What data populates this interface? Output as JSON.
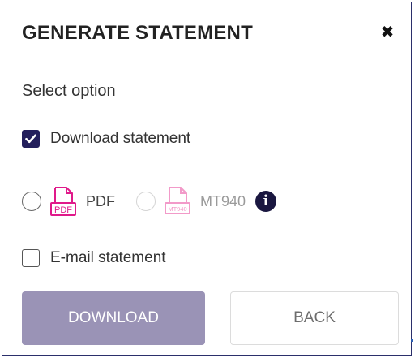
{
  "dialog": {
    "title": "GENERATE STATEMENT",
    "close_symbol": "✖",
    "select_label": "Select option",
    "download_statement": {
      "label": "Download statement",
      "checked": true
    },
    "formats": [
      {
        "label": "PDF",
        "icon": "pdf-file-icon",
        "icon_text": "PDF",
        "enabled": true,
        "selected": false
      },
      {
        "label": "MT940",
        "icon": "mt940-file-icon",
        "icon_text": "MT940",
        "enabled": false,
        "selected": false
      }
    ],
    "info_symbol": "i",
    "email_statement": {
      "label": "E-mail statement",
      "checked": false
    },
    "buttons": {
      "download_label": "DOWNLOAD",
      "back_label": "BACK"
    },
    "colors": {
      "accent_dark": "#231f5c",
      "pdf_icon": "#e0198a",
      "mt940_icon_disabled": "#f29ac9",
      "download_button_disabled": "#9a93b6"
    }
  }
}
